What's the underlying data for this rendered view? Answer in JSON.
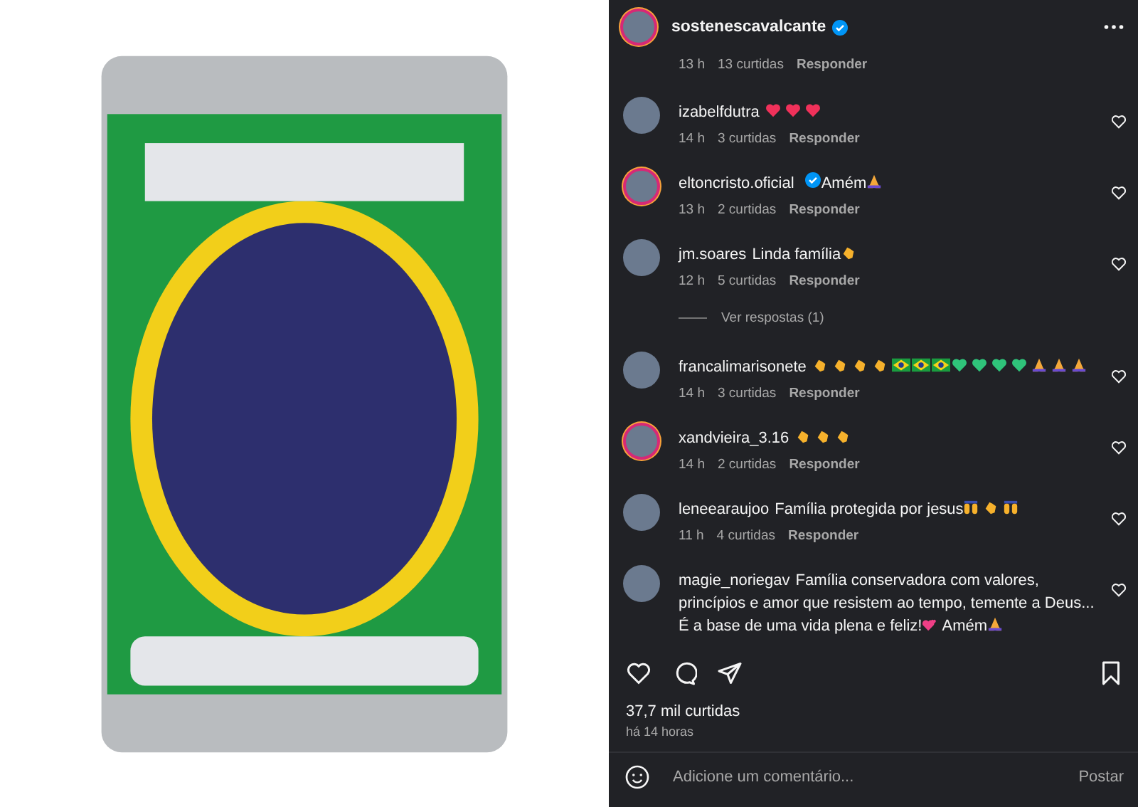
{
  "post": {
    "user": "sostenescavalcante",
    "verified": true,
    "story_ring": true
  },
  "partial_comment": {
    "time": "13 h",
    "likes": "13 curtidas",
    "reply": "Responder"
  },
  "comments": [
    {
      "user": "izabelfdutra",
      "verified": false,
      "story_ring": false,
      "parts": [
        {
          "kind": "heart"
        },
        {
          "kind": "heart"
        },
        {
          "kind": "heart"
        }
      ],
      "time": "14 h",
      "likes": "3 curtidas",
      "reply": "Responder"
    },
    {
      "user": "eltoncristo.oficial",
      "verified": true,
      "story_ring": true,
      "parts": [
        {
          "kind": "text",
          "text": "Amém"
        },
        {
          "kind": "pray"
        }
      ],
      "time": "13 h",
      "likes": "2 curtidas",
      "reply": "Responder"
    },
    {
      "user": "jm.soares",
      "verified": false,
      "story_ring": false,
      "parts": [
        {
          "kind": "text",
          "text": "Linda família"
        },
        {
          "kind": "clap"
        }
      ],
      "time": "12 h",
      "likes": "5 curtidas",
      "reply": "Responder",
      "view_replies": "Ver respostas (1)"
    },
    {
      "user": "francalimarisonete",
      "verified": false,
      "story_ring": false,
      "parts": [
        {
          "kind": "clap"
        },
        {
          "kind": "clap"
        },
        {
          "kind": "clap"
        },
        {
          "kind": "clap"
        },
        {
          "kind": "flag"
        },
        {
          "kind": "flag"
        },
        {
          "kind": "flag"
        },
        {
          "kind": "greenheart"
        },
        {
          "kind": "greenheart"
        },
        {
          "kind": "greenheart"
        },
        {
          "kind": "greenheart"
        },
        {
          "kind": "pray"
        },
        {
          "kind": "pray"
        },
        {
          "kind": "pray"
        }
      ],
      "time": "14 h",
      "likes": "3 curtidas",
      "reply": "Responder"
    },
    {
      "user": "xandvieira_3.16",
      "verified": false,
      "story_ring": true,
      "parts": [
        {
          "kind": "clap"
        },
        {
          "kind": "clap"
        },
        {
          "kind": "clap"
        }
      ],
      "time": "14 h",
      "likes": "2 curtidas",
      "reply": "Responder"
    },
    {
      "user": "leneearaujoo",
      "verified": false,
      "story_ring": false,
      "parts": [
        {
          "kind": "text",
          "text": "Família protegida por jesus"
        },
        {
          "kind": "hands"
        },
        {
          "kind": "clap"
        },
        {
          "kind": "hands"
        }
      ],
      "time": "11 h",
      "likes": "4 curtidas",
      "reply": "Responder"
    },
    {
      "user": "magie_noriegav",
      "verified": false,
      "story_ring": false,
      "parts": [
        {
          "kind": "text",
          "text": "Família conservadora com valores, princípios e amor que resistem ao tempo, temente a Deus... É a base de uma vida plena e feliz!"
        },
        {
          "kind": "twohearts"
        },
        {
          "kind": "text",
          "text": "Amém"
        },
        {
          "kind": "pray"
        }
      ]
    }
  ],
  "likes_total": "37,7 mil curtidas",
  "posted": "há 14 horas",
  "comment_input": {
    "placeholder": "Adicione um comentário..."
  },
  "post_button": "Postar"
}
